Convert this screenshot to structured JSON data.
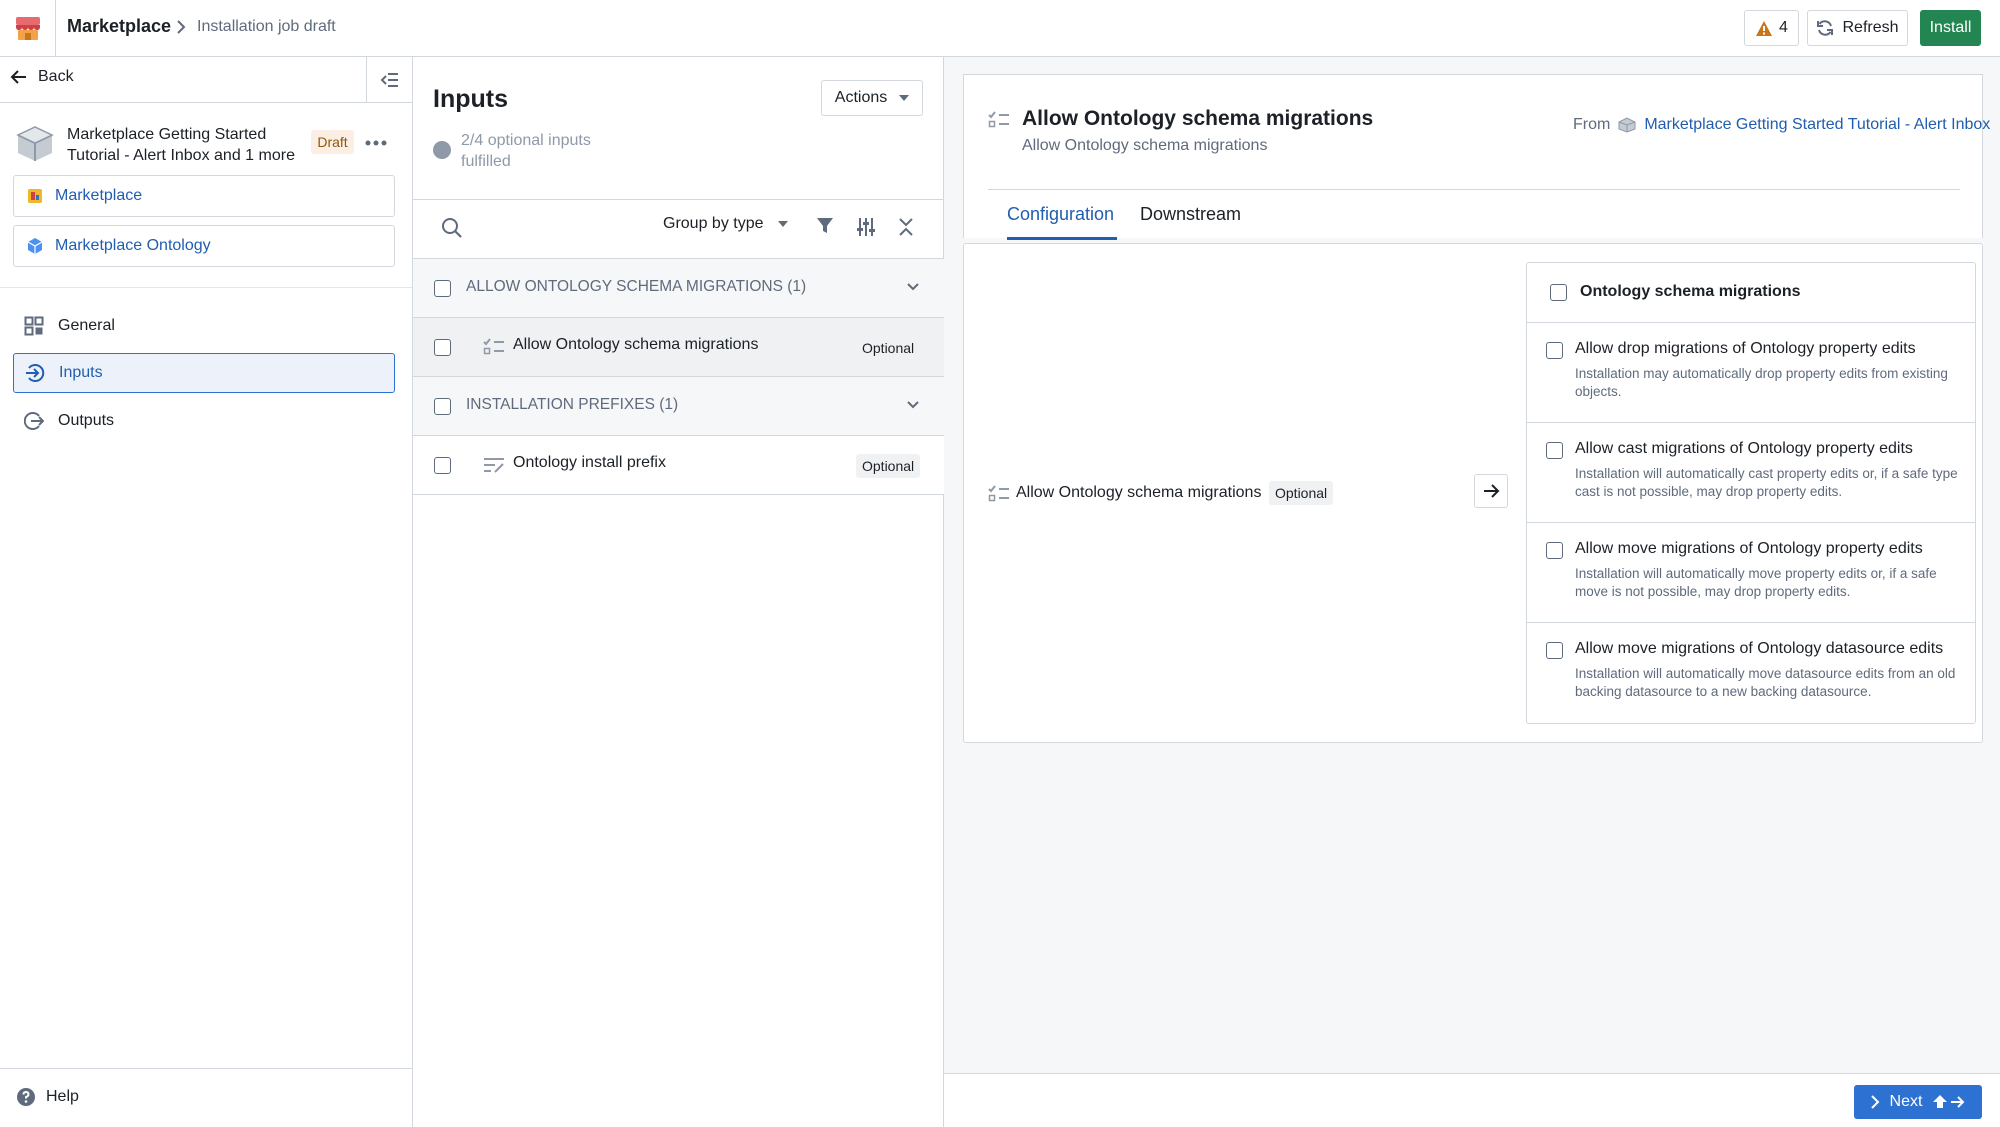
{
  "topbar": {
    "app_name": "Marketplace",
    "page_name": "Installation job draft",
    "warning_count": "4",
    "refresh_label": "Refresh",
    "install_label": "Install"
  },
  "sidebar": {
    "back_label": "Back",
    "package_title": "Marketplace Getting Started Tutorial - Alert Inbox and 1 more",
    "draft_badge": "Draft",
    "links": [
      {
        "label": "Marketplace",
        "icon": "marketplace-icon"
      },
      {
        "label": "Marketplace Ontology",
        "icon": "ontology-cube-icon"
      }
    ],
    "nav": [
      {
        "label": "General",
        "icon": "grid-icon"
      },
      {
        "label": "Inputs",
        "icon": "log-in-icon",
        "active": true
      },
      {
        "label": "Outputs",
        "icon": "log-out-icon"
      }
    ],
    "help_label": "Help"
  },
  "inputs_panel": {
    "title": "Inputs",
    "actions_label": "Actions",
    "progress_text": "2/4 optional inputs fulfilled",
    "group_by_label": "Group by type",
    "rows": [
      {
        "type": "group",
        "label": "ALLOW ONTOLOGY SCHEMA MIGRATIONS (1)"
      },
      {
        "type": "item",
        "label": "Allow Ontology schema migrations",
        "badge": "Optional",
        "icon": "checklist-icon"
      },
      {
        "type": "group",
        "label": "INSTALLATION PREFIXES (1)"
      },
      {
        "type": "item",
        "label": "Ontology install prefix",
        "badge": "Optional",
        "icon": "text-prefix-icon"
      }
    ]
  },
  "detail": {
    "title": "Allow Ontology schema migrations",
    "subtitle": "Allow Ontology schema migrations",
    "from_label": "From",
    "from_link": "Marketplace Getting Started Tutorial - Alert Inbox",
    "tabs": [
      "Configuration",
      "Downstream"
    ],
    "config_label": "Allow Ontology schema migrations",
    "config_badge": "Optional",
    "options_header": "Ontology schema migrations",
    "options": [
      {
        "title": "Allow drop migrations of Ontology property edits",
        "desc": "Installation may automatically drop property edits from existing objects."
      },
      {
        "title": "Allow cast migrations of Ontology property edits",
        "desc": "Installation will automatically cast property edits or, if a safe type cast is not possible, may drop property edits."
      },
      {
        "title": "Allow move migrations of Ontology property edits",
        "desc": "Installation will automatically move property edits or, if a safe move is not possible, may drop property edits."
      },
      {
        "title": "Allow move migrations of Ontology datasource edits",
        "desc": "Installation will automatically move datasource edits from an old backing datasource to a new backing datasource."
      }
    ],
    "next_label": "Next"
  },
  "colors": {
    "primary": "#2d72d2",
    "link": "#215db0",
    "success": "#238551",
    "warning": "#c87619"
  }
}
